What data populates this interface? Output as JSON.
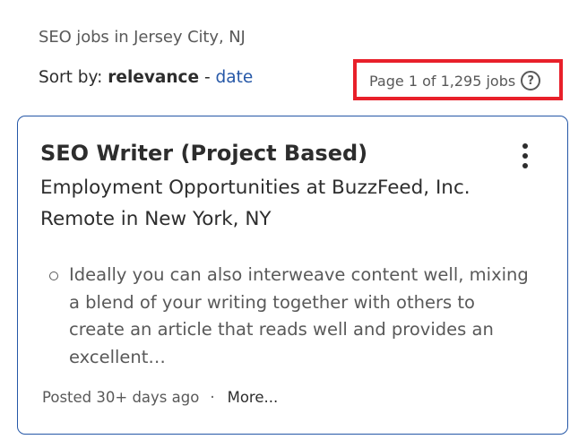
{
  "search": {
    "heading": "SEO jobs in Jersey City, NJ"
  },
  "sort": {
    "label": "Sort by:",
    "active": "relevance",
    "separator": "-",
    "alternate": "date"
  },
  "pagination": {
    "summary": "Page 1 of 1,295 jobs",
    "help_icon": "question-circle-icon",
    "highlight_color": "#e8202a"
  },
  "job": {
    "title": "SEO Writer (Project Based)",
    "company": "Employment Opportunities at BuzzFeed, Inc.",
    "location": "Remote in New York, NY",
    "snippet": "Ideally you can also interweave content well, mixing a blend of your writing together with others to create an article that reads well and provides an excellent…",
    "posted": "Posted 30+ days ago",
    "separator": "·",
    "more_label": "More...",
    "menu_icon": "vertical-ellipsis-icon",
    "border_color": "#2557a7"
  }
}
